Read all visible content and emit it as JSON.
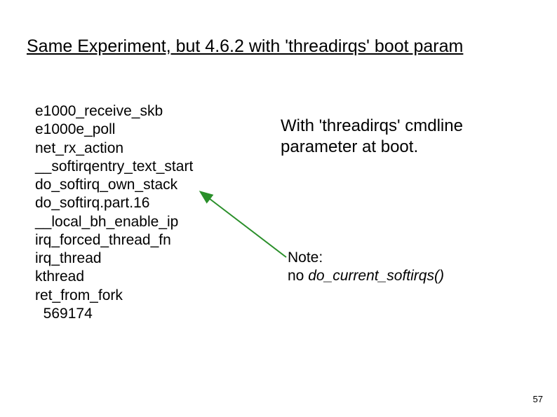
{
  "title": "Same Experiment, but 4.6.2 with 'threadirqs' boot param",
  "stack": {
    "lines": [
      "e1000_receive_skb",
      "e1000e_poll",
      "net_rx_action",
      "__softirqentry_text_start",
      "do_softirq_own_stack",
      "do_softirq.part.16",
      "__local_bh_enable_ip",
      "irq_forced_thread_fn",
      "irq_thread",
      "kthread",
      "ret_from_fork",
      "  569174"
    ]
  },
  "comment": {
    "line1": "With 'threadirqs' cmdline",
    "line2": "parameter at boot."
  },
  "note": {
    "label": "Note:",
    "line1_prefix": "no ",
    "line1_func": "do_current_softirqs()"
  },
  "page_number": "57",
  "arrow": {
    "color": "#2a8f2a"
  }
}
